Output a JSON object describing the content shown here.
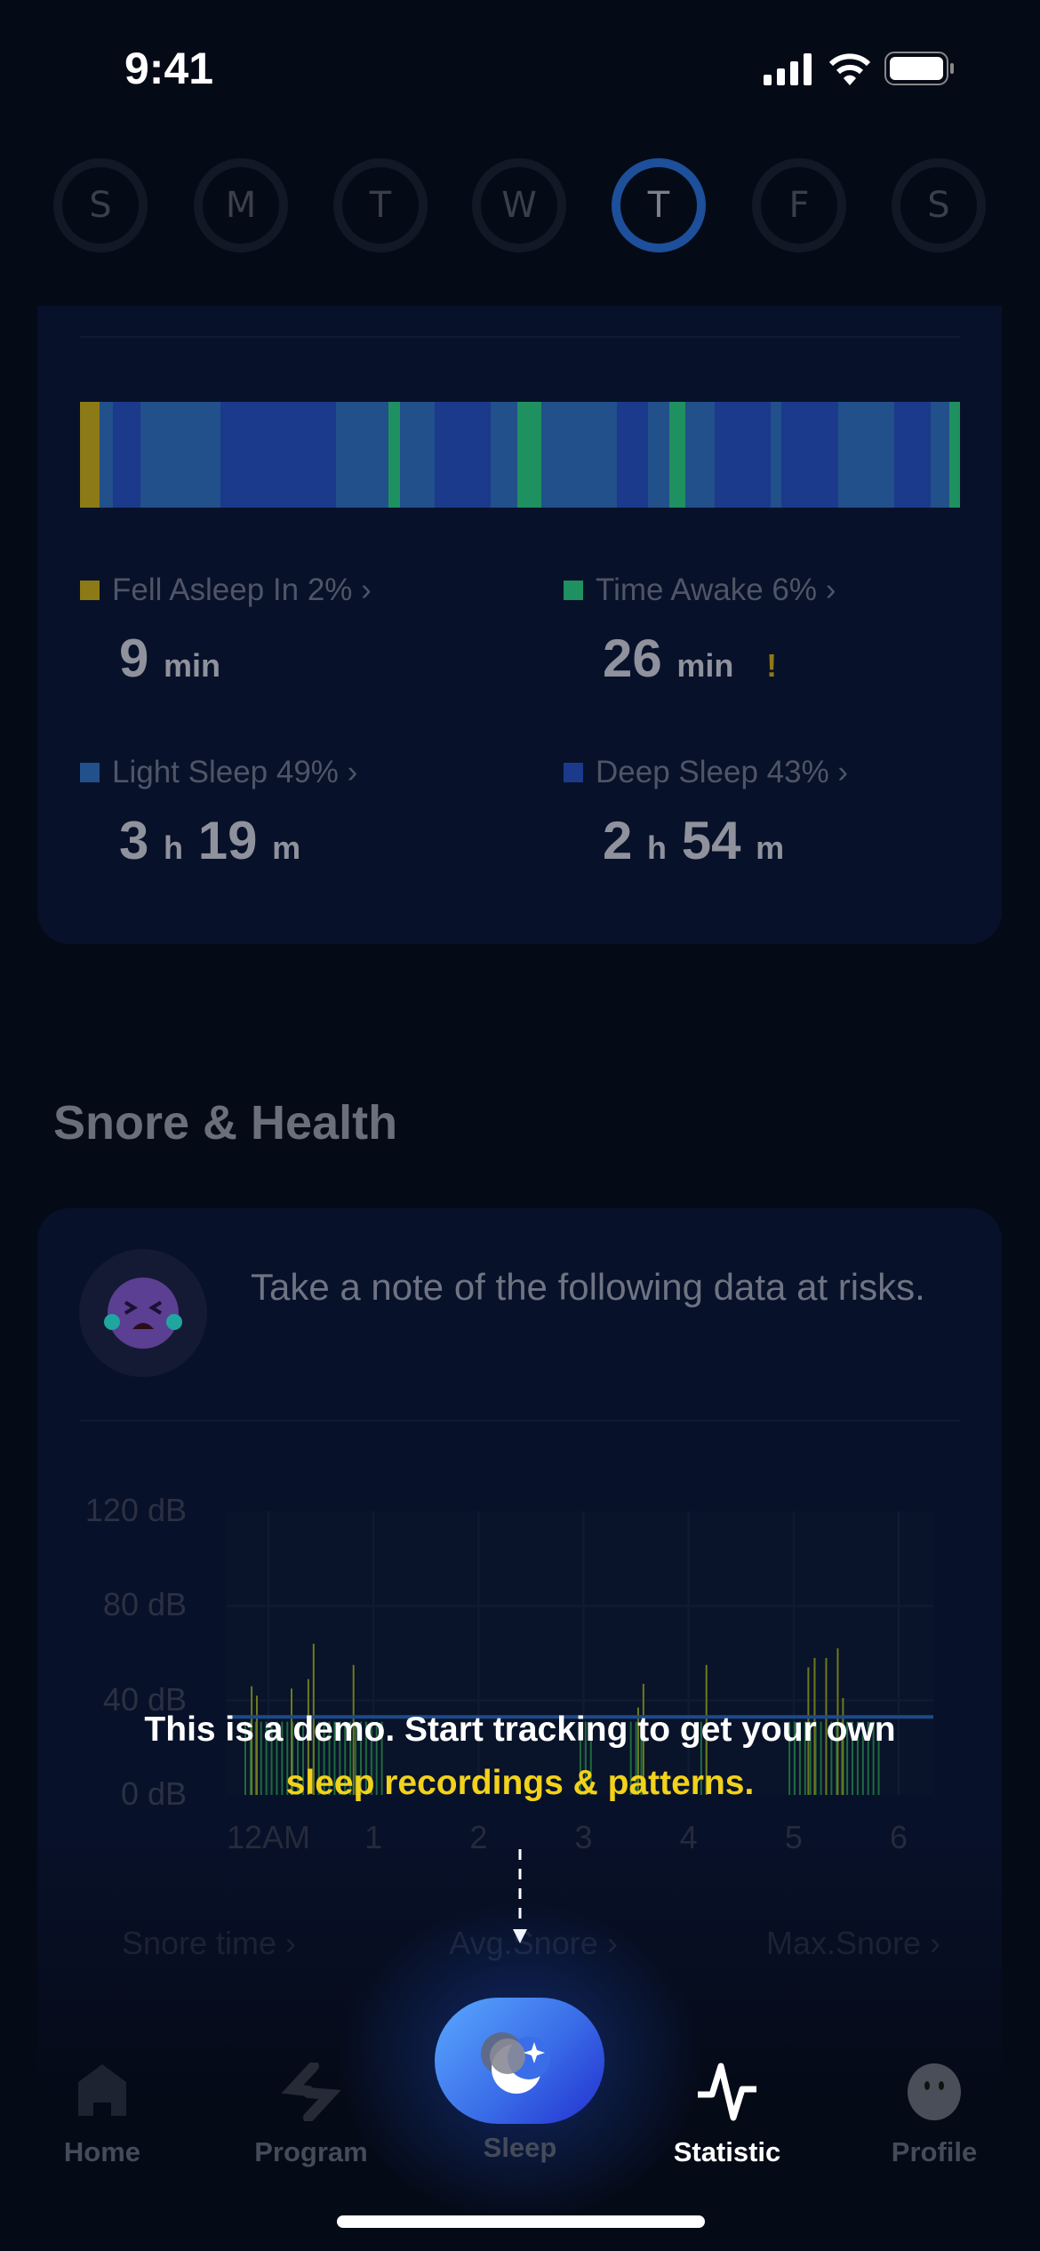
{
  "status_bar": {
    "time": "9:41"
  },
  "week": {
    "days": [
      "S",
      "M",
      "T",
      "W",
      "T",
      "F",
      "S"
    ],
    "selected_index": 4
  },
  "sleep_stages": {
    "colors": {
      "fell_asleep": "#8c7a16",
      "awake": "#1f9060",
      "light": "#22508a",
      "deep": "#1b3a8c"
    },
    "timeline": [
      [
        "fell_asleep",
        29
      ],
      [
        "light",
        20
      ],
      [
        "deep",
        42
      ],
      [
        "light",
        121
      ],
      [
        "deep",
        174
      ],
      [
        "light",
        79
      ],
      [
        "awake",
        17
      ],
      [
        "light",
        52
      ],
      [
        "deep",
        85
      ],
      [
        "light",
        40
      ],
      [
        "awake",
        36
      ],
      [
        "light",
        114
      ],
      [
        "deep",
        47
      ],
      [
        "light",
        32
      ],
      [
        "awake",
        24
      ],
      [
        "light",
        44
      ],
      [
        "deep",
        85
      ],
      [
        "light",
        16
      ],
      [
        "deep",
        85
      ],
      [
        "light",
        85
      ],
      [
        "deep",
        55
      ],
      [
        "light",
        28
      ],
      [
        "awake",
        16
      ]
    ],
    "items": [
      {
        "label": "Fell Asleep In 2% ›",
        "value": "9",
        "unit": "min",
        "color": "#8c7a16"
      },
      {
        "label": "Time Awake 6% ›",
        "value": "26",
        "unit": "min",
        "warning": "!",
        "color": "#1f9060"
      },
      {
        "label": "Light Sleep 49% ›",
        "h": "3",
        "h_unit": "h",
        "m": "19",
        "m_unit": "m",
        "color": "#22508a"
      },
      {
        "label": "Deep Sleep 43% ›",
        "h": "2",
        "h_unit": "h",
        "m": "54",
        "m_unit": "m",
        "color": "#1b3a8c"
      }
    ]
  },
  "snore": {
    "title": "Snore & Health",
    "note": "Take a note of the following data at risks.",
    "stats": [
      "Snore time ›",
      "Avg.Snore ›",
      "Max.Snore ›"
    ]
  },
  "chart_data": {
    "type": "bar",
    "y_ticks": [
      "120 dB",
      "80 dB",
      "40 dB",
      "0 dB"
    ],
    "x_ticks": [
      "12AM",
      "1",
      "2",
      "3",
      "4",
      "5",
      "6"
    ],
    "ylim": [
      0,
      120
    ],
    "xlim_hours": [
      -0.35,
      6.2
    ],
    "baseline_db": 33,
    "spikes": [
      [
        -0.16,
        46
      ],
      [
        -0.11,
        42
      ],
      [
        0.22,
        45
      ],
      [
        0.38,
        49
      ],
      [
        0.43,
        64
      ],
      [
        0.81,
        55
      ],
      [
        3.52,
        37
      ],
      [
        3.57,
        47
      ],
      [
        4.17,
        55
      ],
      [
        5.14,
        54
      ],
      [
        5.2,
        58
      ],
      [
        5.31,
        58
      ],
      [
        5.42,
        62
      ],
      [
        5.47,
        41
      ]
    ],
    "low_activity_ranges": [
      [
        -0.22,
        1.1
      ],
      [
        2.97,
        3.1
      ],
      [
        3.45,
        3.55
      ],
      [
        4.12,
        4.2
      ],
      [
        4.96,
        5.81
      ]
    ],
    "low_activity_db": 31
  },
  "demo_overlay": {
    "line1": "This is a demo. Start tracking to get your own",
    "line2": "sleep recordings & patterns."
  },
  "tabs": [
    {
      "label": "Home"
    },
    {
      "label": "Program"
    },
    {
      "label": "Sleep"
    },
    {
      "label": "Statistic",
      "active": true
    },
    {
      "label": "Profile"
    }
  ]
}
